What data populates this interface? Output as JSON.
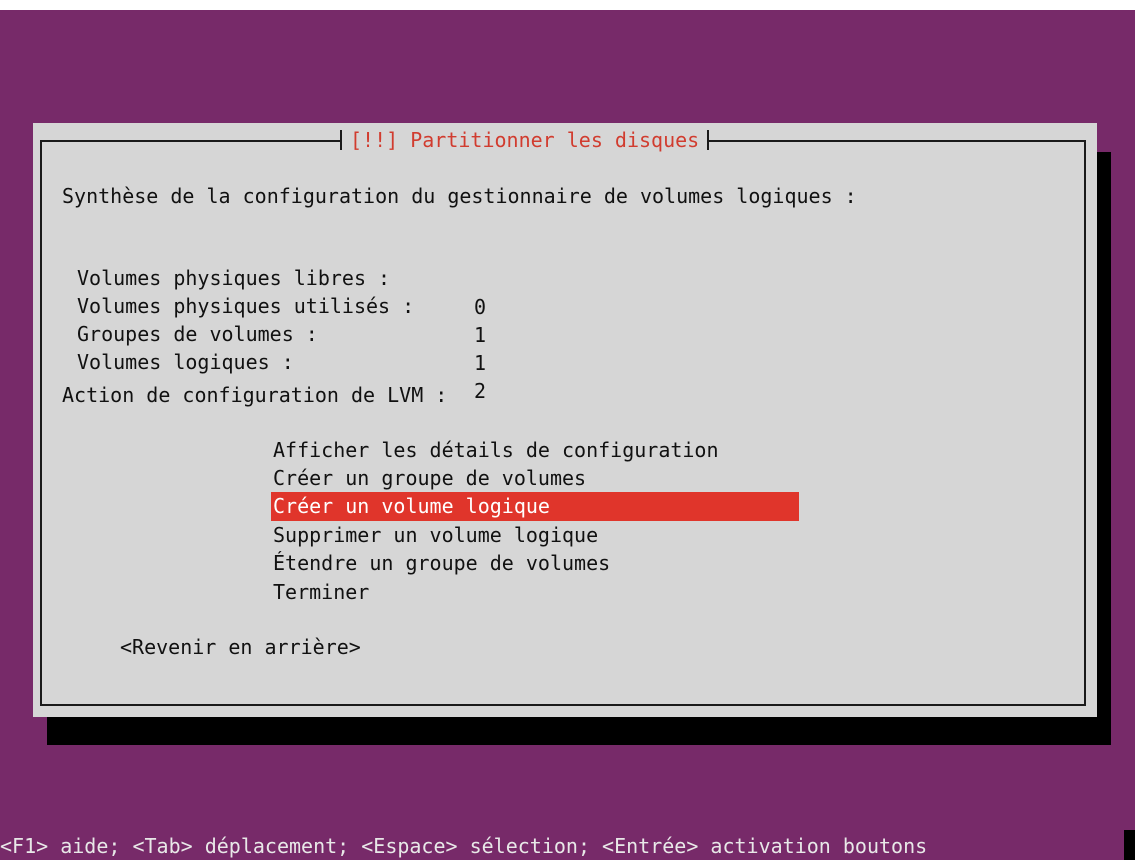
{
  "dialog": {
    "title": "[!!] Partitionner les disques",
    "summary_heading": "Synthèse de la configuration du gestionnaire de volumes logiques :",
    "stats": [
      {
        "label": "Volumes physiques libres :",
        "value": "0"
      },
      {
        "label": "Volumes physiques utilisés :",
        "value": "1"
      },
      {
        "label": "Groupes de volumes :",
        "value": "1"
      },
      {
        "label": "Volumes logiques :",
        "value": "2"
      }
    ],
    "action_heading": "Action de configuration de LVM :",
    "menu": [
      {
        "label": "Afficher les détails de configuration"
      },
      {
        "label": "Créer un groupe de volumes"
      },
      {
        "label": "Créer un volume logique",
        "selected": true
      },
      {
        "label": "Supprimer un volume logique"
      },
      {
        "label": "Étendre un groupe de volumes"
      },
      {
        "label": "Terminer"
      }
    ],
    "back_button": "<Revenir en arrière>"
  },
  "help_bar": "<F1> aide; <Tab> déplacement; <Espace> sélection; <Entrée> activation boutons",
  "colors": {
    "background": "#772a69",
    "dialog": "#d6d6d6",
    "title": "#d13c2f",
    "selection": "#e0352b"
  }
}
